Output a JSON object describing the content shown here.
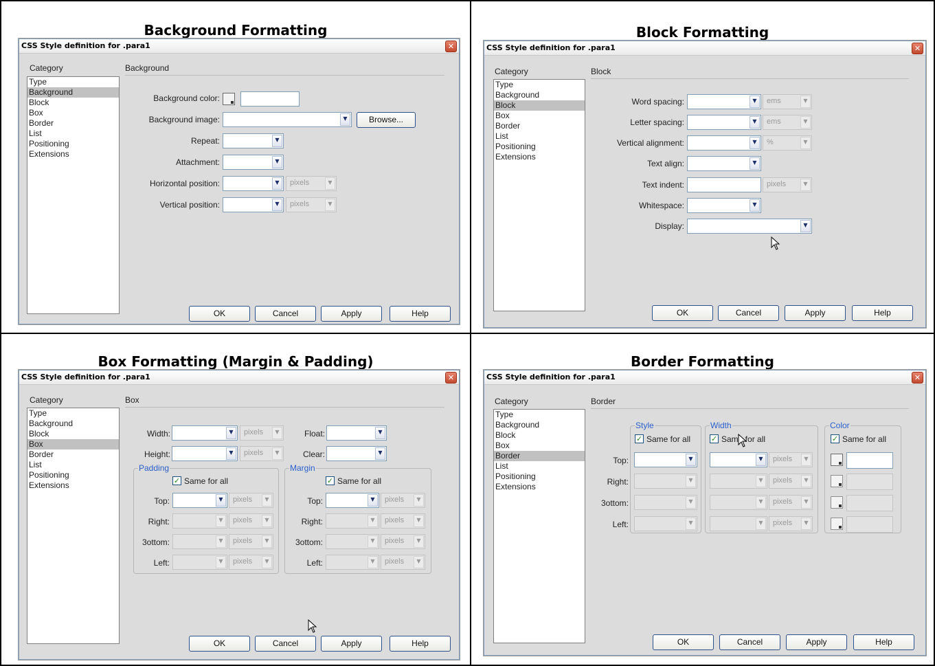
{
  "panels": {
    "background": {
      "heading": "Background Formatting",
      "dialog_title": "CSS Style definition for .para1",
      "category_header": "Category",
      "section_header": "Background",
      "categories": [
        "Type",
        "Background",
        "Block",
        "Box",
        "Border",
        "List",
        "Positioning",
        "Extensions"
      ],
      "selected_category": "Background",
      "fields": {
        "bg_color": "Background color:",
        "bg_image": "Background image:",
        "repeat": "Repeat:",
        "attachment": "Attachment:",
        "hpos": "Horizontal position:",
        "vpos": "Vertical position:"
      },
      "units": {
        "hpos": "pixels",
        "vpos": "pixels"
      },
      "browse": "Browse...",
      "buttons": {
        "ok": "OK",
        "cancel": "Cancel",
        "apply": "Apply",
        "help": "Help"
      }
    },
    "block": {
      "heading": "Block Formatting",
      "dialog_title": "CSS Style definition for .para1",
      "category_header": "Category",
      "section_header": "Block",
      "categories": [
        "Type",
        "Background",
        "Block",
        "Box",
        "Border",
        "List",
        "Positioning",
        "Extensions"
      ],
      "selected_category": "Block",
      "fields": {
        "word_spacing": "Word spacing:",
        "letter_spacing": "Letter spacing:",
        "vertical_alignment": "Vertical alignment:",
        "text_align": "Text align:",
        "text_indent": "Text indent:",
        "whitespace": "Whitespace:",
        "display": "Display:"
      },
      "units": {
        "word_spacing": "ems",
        "letter_spacing": "ems",
        "vertical_alignment": "%",
        "text_indent": "pixels"
      },
      "buttons": {
        "ok": "OK",
        "cancel": "Cancel",
        "apply": "Apply",
        "help": "Help"
      }
    },
    "box": {
      "heading": "Box Formatting (Margin & Padding)",
      "dialog_title": "CSS Style definition for .para1",
      "category_header": "Category",
      "section_header": "Box",
      "categories": [
        "Type",
        "Background",
        "Block",
        "Box",
        "Border",
        "List",
        "Positioning",
        "Extensions"
      ],
      "selected_category": "Box",
      "fields": {
        "width": "Width:",
        "height": "Height:",
        "float": "Float:",
        "clear": "Clear:"
      },
      "units": {
        "width": "pixels",
        "height": "pixels"
      },
      "padding": {
        "title": "Padding",
        "same_for_all": "Same for all",
        "checked": true,
        "rows": [
          {
            "label": "Top:",
            "unit": "pixels"
          },
          {
            "label": "Right:",
            "unit": "pixels"
          },
          {
            "label": "3ottom:",
            "unit": "pixels"
          },
          {
            "label": "Left:",
            "unit": "pixels"
          }
        ]
      },
      "margin": {
        "title": "Margin",
        "same_for_all": "Same for all",
        "checked": true,
        "rows": [
          {
            "label": "Top:",
            "unit": "pixels"
          },
          {
            "label": "Right:",
            "unit": "pixels"
          },
          {
            "label": "3ottom:",
            "unit": "pixels"
          },
          {
            "label": "Left:",
            "unit": "pixels"
          }
        ]
      },
      "buttons": {
        "ok": "OK",
        "cancel": "Cancel",
        "apply": "Apply",
        "help": "Help"
      }
    },
    "border": {
      "heading": "Border Formatting",
      "dialog_title": "CSS Style definition for .para1",
      "category_header": "Category",
      "section_header": "Border",
      "categories": [
        "Type",
        "Background",
        "Block",
        "Box",
        "Border",
        "List",
        "Positioning",
        "Extensions"
      ],
      "selected_category": "Border",
      "groups": {
        "style": {
          "title": "Style",
          "same_for_all": "Same for all",
          "checked": true
        },
        "width": {
          "title": "Width",
          "same_for_all": "Same for all",
          "checked": true
        },
        "color": {
          "title": "Color",
          "same_for_all": "Same for all",
          "checked": true
        }
      },
      "rows": [
        {
          "label": "Top:",
          "unit": "pixels"
        },
        {
          "label": "Right:",
          "unit": "pixels"
        },
        {
          "label": "3ottom:",
          "unit": "pixels"
        },
        {
          "label": "Left:",
          "unit": "pixels"
        }
      ],
      "buttons": {
        "ok": "OK",
        "cancel": "Cancel",
        "apply": "Apply",
        "help": "Help"
      }
    }
  },
  "icons": {
    "close": "close-icon",
    "dropdown": "chevron-down-icon",
    "checkbox": "checkmark-icon",
    "cursor": "mouse-pointer-icon"
  },
  "colors": {
    "title_close": "#c24a30",
    "group_title": "#2a5fca",
    "selected_item": "#c1c1c1",
    "dialog_bg": "#dcdcdc"
  }
}
